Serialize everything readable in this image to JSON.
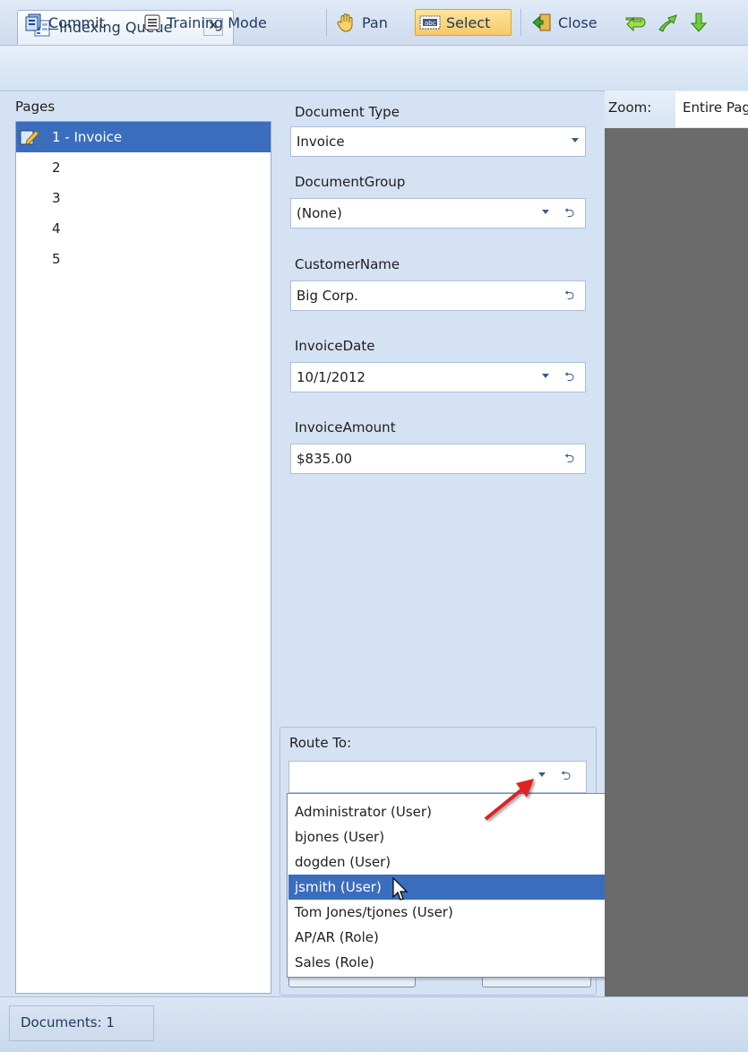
{
  "tab": {
    "title": "Indexing Queue",
    "close": "✕",
    "icon": "document-grid-icon"
  },
  "toolbar": {
    "commit_pre": "",
    "commit_ul": "C",
    "commit_post": "ommit",
    "training_mode": "Training Mode",
    "pan": "Pan",
    "select": "Select",
    "close": "Close",
    "icons": [
      "commit-icon",
      "training-mode-icon",
      "hand-pan-icon",
      "select-text-icon",
      "close-door-icon",
      "return-arrow-icon",
      "up-arrow-icon",
      "down-arrow-icon"
    ]
  },
  "pages": {
    "title": "Pages",
    "items": [
      {
        "label": "1 - Invoice",
        "selected": true
      },
      {
        "label": "2"
      },
      {
        "label": "3"
      },
      {
        "label": "4"
      },
      {
        "label": "5"
      }
    ]
  },
  "form": {
    "document_type": {
      "label": "Document Type",
      "value": "Invoice"
    },
    "document_group": {
      "label": "DocumentGroup",
      "value": "(None)"
    },
    "customer_name": {
      "label": "CustomerName",
      "value": "Big Corp."
    },
    "invoice_date": {
      "label": "InvoiceDate",
      "value": "10/1/2012"
    },
    "invoice_amount": {
      "label": "InvoiceAmount",
      "value": "$835.00"
    },
    "undo_glyph": "⮌"
  },
  "route": {
    "label": "Route To:",
    "value": "",
    "options": [
      "Administrator (User)",
      "bjones (User)",
      "dogden (User)",
      "jsmith (User)",
      "Tom Jones/tjones (User)",
      "AP/AR (Role)",
      "Sales (Role)"
    ],
    "highlighted_index": 3
  },
  "viewer": {
    "zoom_label": "Zoom:",
    "zoom_value": "Entire Page"
  },
  "status": {
    "documents": "Documents: 1"
  },
  "colors": {
    "selection": "#3b6dbf",
    "viewer_bg": "#6b6b6b",
    "annotation_arrow": "#e02020"
  }
}
